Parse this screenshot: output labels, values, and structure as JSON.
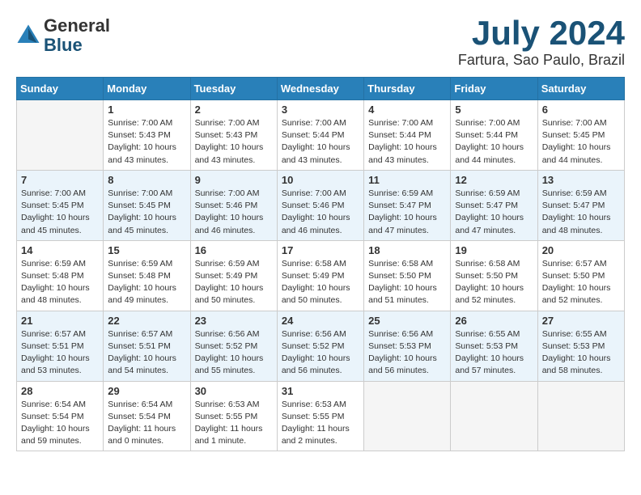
{
  "header": {
    "logo": {
      "line1": "General",
      "line2": "Blue"
    },
    "title": "July 2024",
    "location": "Fartura, Sao Paulo, Brazil"
  },
  "weekdays": [
    "Sunday",
    "Monday",
    "Tuesday",
    "Wednesday",
    "Thursday",
    "Friday",
    "Saturday"
  ],
  "weeks": [
    [
      {
        "day": "",
        "info": ""
      },
      {
        "day": "1",
        "info": "Sunrise: 7:00 AM\nSunset: 5:43 PM\nDaylight: 10 hours\nand 43 minutes."
      },
      {
        "day": "2",
        "info": "Sunrise: 7:00 AM\nSunset: 5:43 PM\nDaylight: 10 hours\nand 43 minutes."
      },
      {
        "day": "3",
        "info": "Sunrise: 7:00 AM\nSunset: 5:44 PM\nDaylight: 10 hours\nand 43 minutes."
      },
      {
        "day": "4",
        "info": "Sunrise: 7:00 AM\nSunset: 5:44 PM\nDaylight: 10 hours\nand 43 minutes."
      },
      {
        "day": "5",
        "info": "Sunrise: 7:00 AM\nSunset: 5:44 PM\nDaylight: 10 hours\nand 44 minutes."
      },
      {
        "day": "6",
        "info": "Sunrise: 7:00 AM\nSunset: 5:45 PM\nDaylight: 10 hours\nand 44 minutes."
      }
    ],
    [
      {
        "day": "7",
        "info": "Sunrise: 7:00 AM\nSunset: 5:45 PM\nDaylight: 10 hours\nand 45 minutes."
      },
      {
        "day": "8",
        "info": "Sunrise: 7:00 AM\nSunset: 5:45 PM\nDaylight: 10 hours\nand 45 minutes."
      },
      {
        "day": "9",
        "info": "Sunrise: 7:00 AM\nSunset: 5:46 PM\nDaylight: 10 hours\nand 46 minutes."
      },
      {
        "day": "10",
        "info": "Sunrise: 7:00 AM\nSunset: 5:46 PM\nDaylight: 10 hours\nand 46 minutes."
      },
      {
        "day": "11",
        "info": "Sunrise: 6:59 AM\nSunset: 5:47 PM\nDaylight: 10 hours\nand 47 minutes."
      },
      {
        "day": "12",
        "info": "Sunrise: 6:59 AM\nSunset: 5:47 PM\nDaylight: 10 hours\nand 47 minutes."
      },
      {
        "day": "13",
        "info": "Sunrise: 6:59 AM\nSunset: 5:47 PM\nDaylight: 10 hours\nand 48 minutes."
      }
    ],
    [
      {
        "day": "14",
        "info": "Sunrise: 6:59 AM\nSunset: 5:48 PM\nDaylight: 10 hours\nand 48 minutes."
      },
      {
        "day": "15",
        "info": "Sunrise: 6:59 AM\nSunset: 5:48 PM\nDaylight: 10 hours\nand 49 minutes."
      },
      {
        "day": "16",
        "info": "Sunrise: 6:59 AM\nSunset: 5:49 PM\nDaylight: 10 hours\nand 50 minutes."
      },
      {
        "day": "17",
        "info": "Sunrise: 6:58 AM\nSunset: 5:49 PM\nDaylight: 10 hours\nand 50 minutes."
      },
      {
        "day": "18",
        "info": "Sunrise: 6:58 AM\nSunset: 5:50 PM\nDaylight: 10 hours\nand 51 minutes."
      },
      {
        "day": "19",
        "info": "Sunrise: 6:58 AM\nSunset: 5:50 PM\nDaylight: 10 hours\nand 52 minutes."
      },
      {
        "day": "20",
        "info": "Sunrise: 6:57 AM\nSunset: 5:50 PM\nDaylight: 10 hours\nand 52 minutes."
      }
    ],
    [
      {
        "day": "21",
        "info": "Sunrise: 6:57 AM\nSunset: 5:51 PM\nDaylight: 10 hours\nand 53 minutes."
      },
      {
        "day": "22",
        "info": "Sunrise: 6:57 AM\nSunset: 5:51 PM\nDaylight: 10 hours\nand 54 minutes."
      },
      {
        "day": "23",
        "info": "Sunrise: 6:56 AM\nSunset: 5:52 PM\nDaylight: 10 hours\nand 55 minutes."
      },
      {
        "day": "24",
        "info": "Sunrise: 6:56 AM\nSunset: 5:52 PM\nDaylight: 10 hours\nand 56 minutes."
      },
      {
        "day": "25",
        "info": "Sunrise: 6:56 AM\nSunset: 5:53 PM\nDaylight: 10 hours\nand 56 minutes."
      },
      {
        "day": "26",
        "info": "Sunrise: 6:55 AM\nSunset: 5:53 PM\nDaylight: 10 hours\nand 57 minutes."
      },
      {
        "day": "27",
        "info": "Sunrise: 6:55 AM\nSunset: 5:53 PM\nDaylight: 10 hours\nand 58 minutes."
      }
    ],
    [
      {
        "day": "28",
        "info": "Sunrise: 6:54 AM\nSunset: 5:54 PM\nDaylight: 10 hours\nand 59 minutes."
      },
      {
        "day": "29",
        "info": "Sunrise: 6:54 AM\nSunset: 5:54 PM\nDaylight: 11 hours\nand 0 minutes."
      },
      {
        "day": "30",
        "info": "Sunrise: 6:53 AM\nSunset: 5:55 PM\nDaylight: 11 hours\nand 1 minute."
      },
      {
        "day": "31",
        "info": "Sunrise: 6:53 AM\nSunset: 5:55 PM\nDaylight: 11 hours\nand 2 minutes."
      },
      {
        "day": "",
        "info": ""
      },
      {
        "day": "",
        "info": ""
      },
      {
        "day": "",
        "info": ""
      }
    ]
  ]
}
